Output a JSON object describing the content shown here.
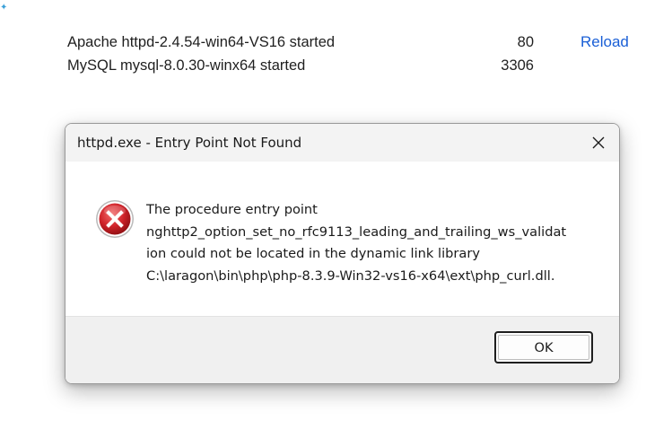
{
  "background_app": {
    "corner_glyph": "✦",
    "services": [
      {
        "name": "Apache httpd-2.4.54-win64-VS16 started",
        "port": "80",
        "action": "Reload"
      },
      {
        "name": "MySQL mysql-8.0.30-winx64 started",
        "port": "3306",
        "action": ""
      }
    ],
    "link_color": "#1a5fd6"
  },
  "dialog": {
    "title": "httpd.exe - Entry Point Not Found",
    "close_icon": "close-icon",
    "error_icon": "error-icon",
    "error_color": "#c8161e",
    "message_lines": [
      "The procedure entry point",
      "nghttp2_option_set_no_rfc9113_leading_and_trailing_ws_validat",
      "ion could not be located in the dynamic link library",
      "C:\\laragon\\bin\\php\\php-8.3.9-Win32-vs16-x64\\ext\\php_curl.dll."
    ],
    "ok_label": "OK"
  }
}
